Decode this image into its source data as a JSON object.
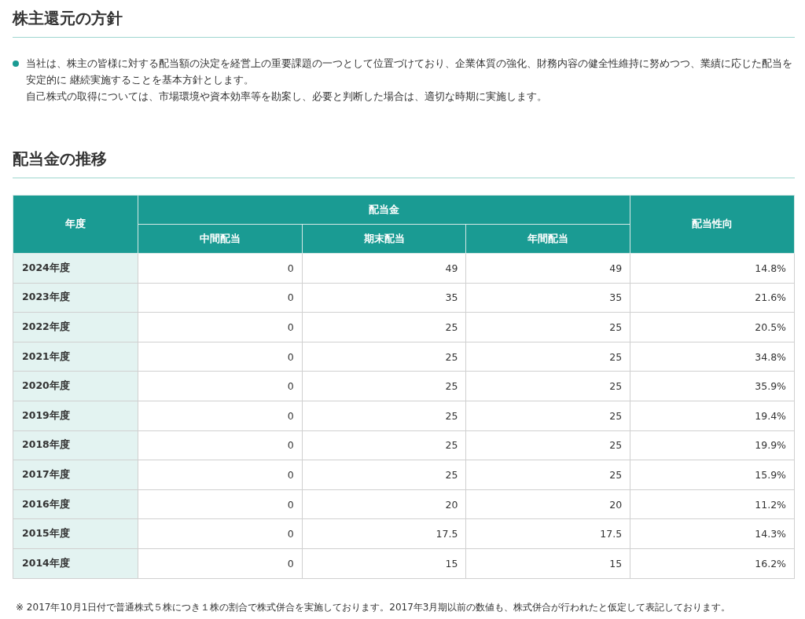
{
  "policy": {
    "title": "株主還元の方針",
    "paragraphs": [
      "当社は、株主の皆様に対する配当額の決定を経営上の重要課題の一つとして位置づけており、企業体質の強化、財務内容の健全性維持に努めつつ、業績に応じた配当を安定的に 継続実施することを基本方針とします。",
      "自己株式の取得については、市場環境や資本効率等を勘案し、必要と判断した場合は、適切な時期に実施します。"
    ]
  },
  "dividends": {
    "title": "配当金の推移",
    "table": {
      "year_header": "年度",
      "group_header": "配当金",
      "sub_headers": [
        "中間配当",
        "期末配当",
        "年間配当"
      ],
      "ratio_header": "配当性向",
      "rows": [
        {
          "year": "2024年度",
          "interim": "0",
          "year_end": "49",
          "annual": "49",
          "ratio": "14.8%"
        },
        {
          "year": "2023年度",
          "interim": "0",
          "year_end": "35",
          "annual": "35",
          "ratio": "21.6%"
        },
        {
          "year": "2022年度",
          "interim": "0",
          "year_end": "25",
          "annual": "25",
          "ratio": "20.5%"
        },
        {
          "year": "2021年度",
          "interim": "0",
          "year_end": "25",
          "annual": "25",
          "ratio": "34.8%"
        },
        {
          "year": "2020年度",
          "interim": "0",
          "year_end": "25",
          "annual": "25",
          "ratio": "35.9%"
        },
        {
          "year": "2019年度",
          "interim": "0",
          "year_end": "25",
          "annual": "25",
          "ratio": "19.4%"
        },
        {
          "year": "2018年度",
          "interim": "0",
          "year_end": "25",
          "annual": "25",
          "ratio": "19.9%"
        },
        {
          "year": "2017年度",
          "interim": "0",
          "year_end": "25",
          "annual": "25",
          "ratio": "15.9%"
        },
        {
          "year": "2016年度",
          "interim": "0",
          "year_end": "20",
          "annual": "20",
          "ratio": "11.2%"
        },
        {
          "year": "2015年度",
          "interim": "0",
          "year_end": "17.5",
          "annual": "17.5",
          "ratio": "14.3%"
        },
        {
          "year": "2014年度",
          "interim": "0",
          "year_end": "15",
          "annual": "15",
          "ratio": "16.2%"
        }
      ]
    },
    "note": "※  2017年10月1日付で普通株式５株につき１株の割合で株式併合を実施しております。2017年3月期以前の数値も、株式併合が行われたと仮定して表記しております。"
  }
}
